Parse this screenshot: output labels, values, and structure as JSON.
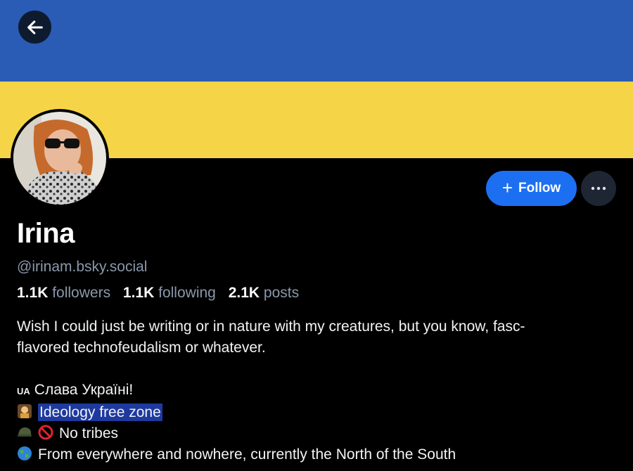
{
  "banner": {
    "top_color": "#2a5bb5",
    "bottom_color": "#f5d547"
  },
  "header": {
    "back_icon": "arrow-left-icon"
  },
  "profile": {
    "display_name": "Irina",
    "handle": "@irinam.bsky.social",
    "stats": {
      "followers_count": "1.1K",
      "followers_label": "followers",
      "following_count": "1.1K",
      "following_label": "following",
      "posts_count": "2.1K",
      "posts_label": "posts"
    }
  },
  "actions": {
    "follow_label": "Follow",
    "more_icon": "ellipsis-icon",
    "accent_color": "#1d6ff2"
  },
  "bio": {
    "line1": "Wish I could just be writing or in nature with my creatures, but you know, fasc-",
    "line2": "flavored technofeudalism or whatever.",
    "flag_code": "UA",
    "line3": "Слава Україні!",
    "line4": "Ideology free zone",
    "line5": "No tribes",
    "line6": "From everywhere and nowhere, currently the North of the South"
  }
}
